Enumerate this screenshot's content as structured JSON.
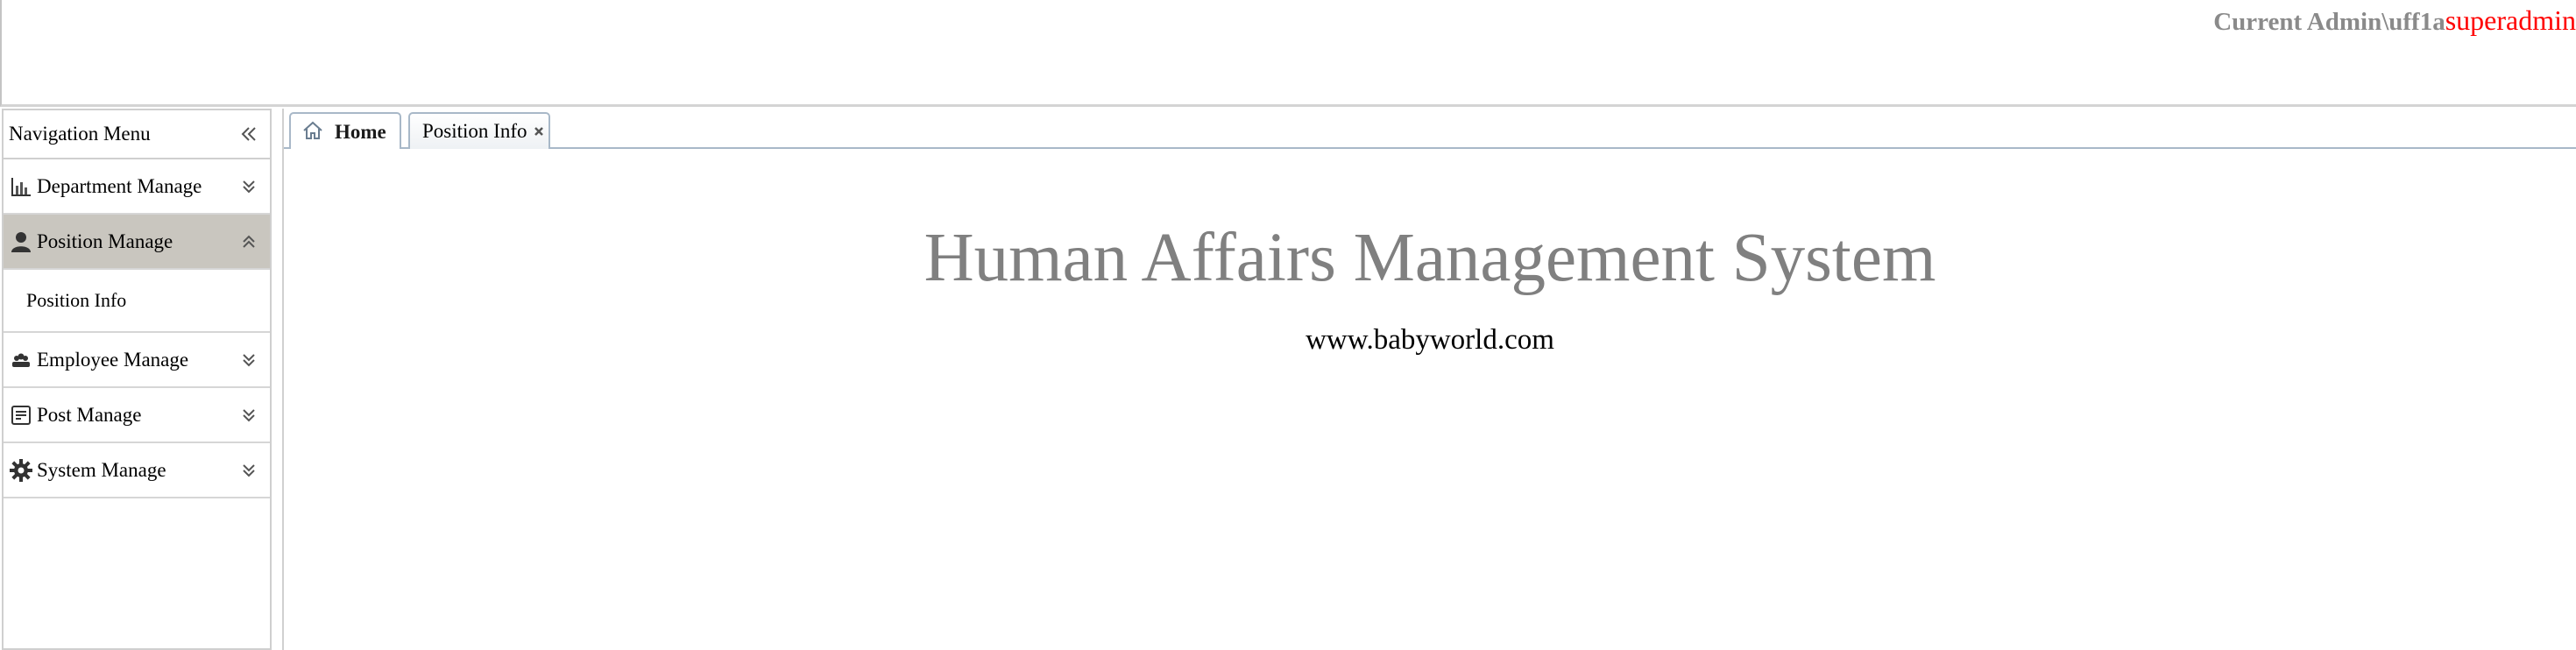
{
  "header": {
    "admin_label": "Current Admin\\uff1a",
    "admin_name": "superadmin"
  },
  "sidebar": {
    "title": "Navigation Menu",
    "groups": [
      {
        "label": "Department Manage",
        "icon": "bar-chart-icon",
        "expanded": false,
        "items": []
      },
      {
        "label": "Position Manage",
        "icon": "user-icon",
        "expanded": true,
        "items": [
          {
            "label": "Position Info"
          }
        ]
      },
      {
        "label": "Employee Manage",
        "icon": "group-icon",
        "expanded": false,
        "items": []
      },
      {
        "label": "Post Manage",
        "icon": "note-icon",
        "expanded": false,
        "items": []
      },
      {
        "label": "System Manage",
        "icon": "gear-icon",
        "expanded": false,
        "items": []
      }
    ]
  },
  "tabs": [
    {
      "label": "Home",
      "icon": "home-icon",
      "active": true,
      "closable": false
    },
    {
      "label": "Position Info",
      "active": false,
      "closable": true
    }
  ],
  "main": {
    "title": "Human Affairs Management System",
    "url": "www.babyworld.com"
  },
  "colors": {
    "admin_name": "#ff0000",
    "active_menu_bg": "#c9c6bf",
    "title_gray": "#808080",
    "tab_border": "#a8b8c8"
  }
}
